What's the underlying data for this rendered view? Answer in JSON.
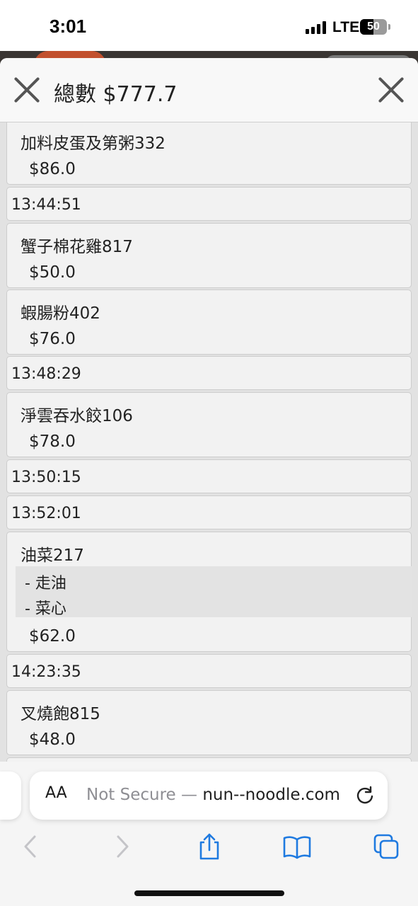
{
  "status_bar": {
    "time": "3:01",
    "network": "LTE",
    "battery": "50",
    "battery_level": 0.5
  },
  "modal": {
    "title": "總數 $777.7",
    "rows": [
      {
        "type": "item",
        "name": "加料皮蛋及第粥332",
        "price": "$86.0"
      },
      {
        "type": "time",
        "text": "13:44:51"
      },
      {
        "type": "item",
        "name": "蟹子棉花雞817",
        "price": "$50.0"
      },
      {
        "type": "item",
        "name": "蝦腸粉402",
        "price": "$76.0"
      },
      {
        "type": "time",
        "text": "13:48:29"
      },
      {
        "type": "item",
        "name": "淨雲吞水餃106",
        "price": "$78.0"
      },
      {
        "type": "time",
        "text": "13:50:15"
      },
      {
        "type": "time",
        "text": "13:52:01"
      },
      {
        "type": "item",
        "name": "油菜217",
        "options": [
          "- 走油",
          "- 菜心"
        ],
        "price": "$62.0"
      },
      {
        "type": "time",
        "text": "14:23:35"
      },
      {
        "type": "item",
        "name": "叉燒飽815",
        "price": "$48.0"
      }
    ]
  },
  "browser": {
    "aa_label": "AA",
    "url_prefix": "Not Secure — ",
    "url_domain": "nun--noodle.com",
    "accent_color": "#1f7ae0"
  }
}
